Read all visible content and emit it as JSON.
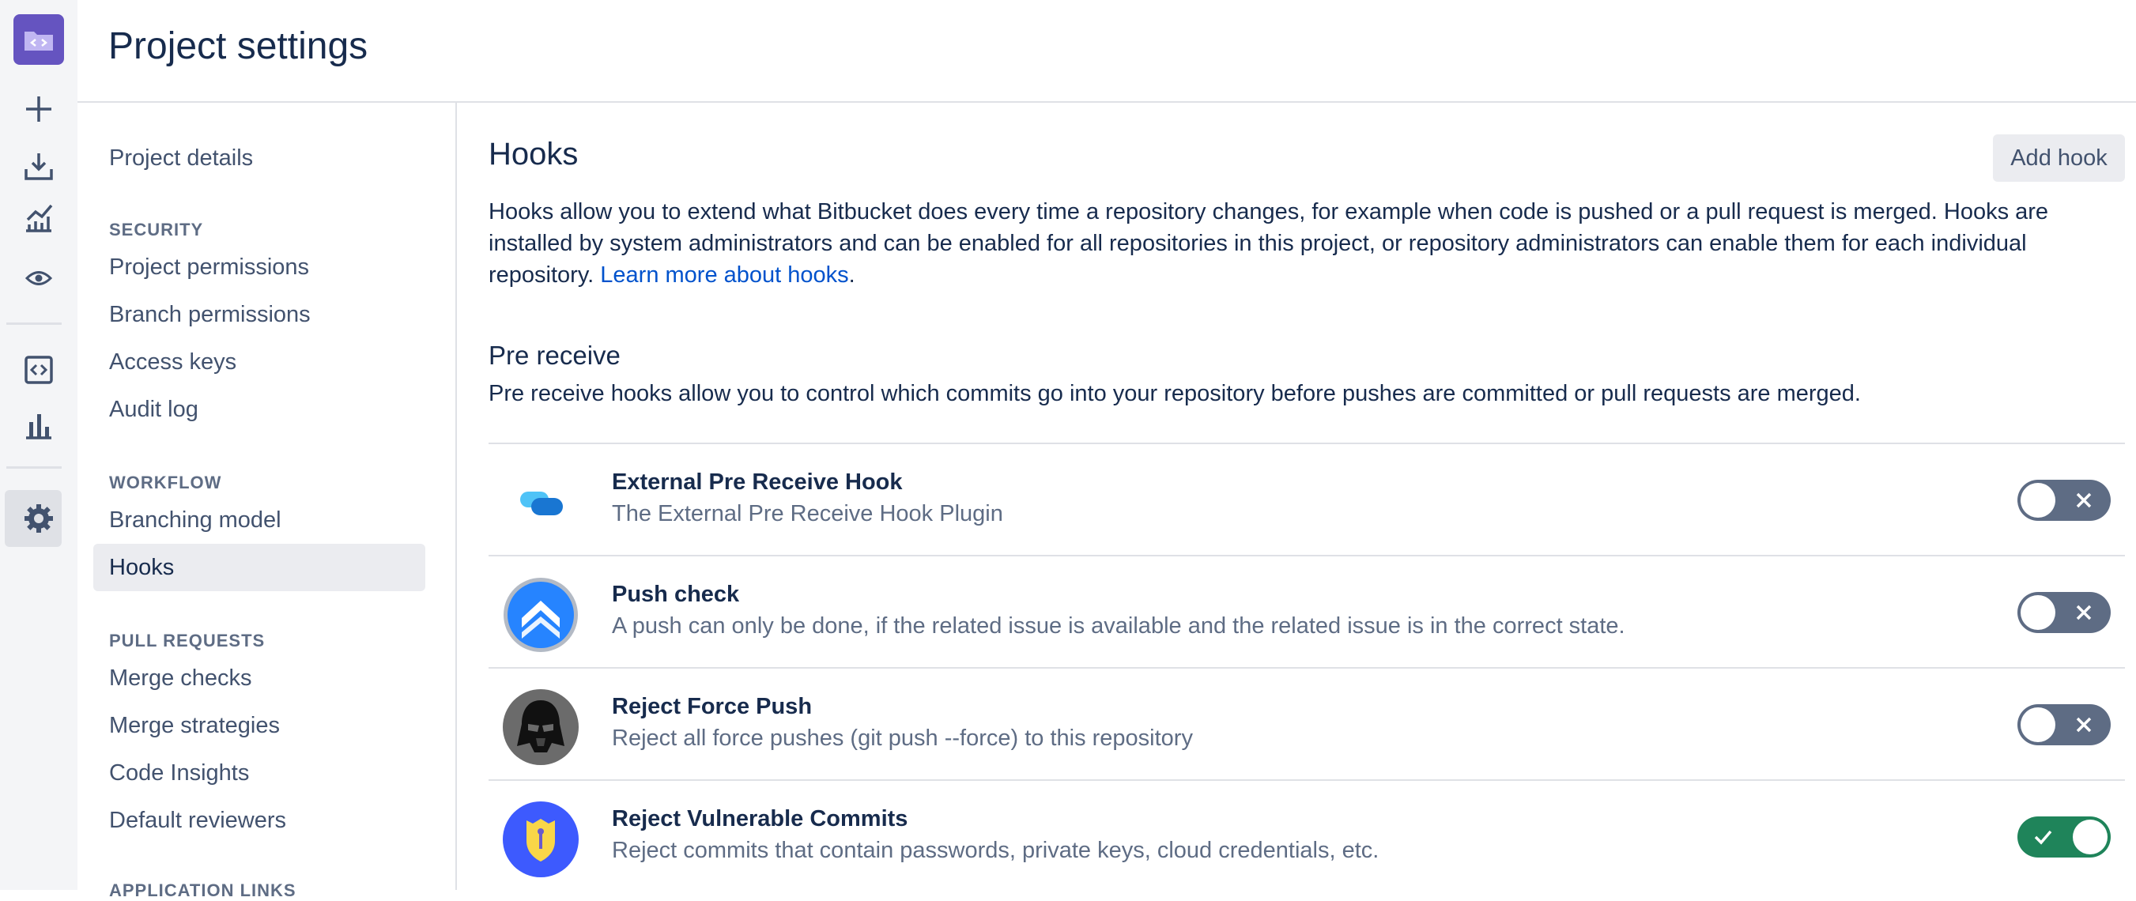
{
  "header": {
    "title": "Project settings"
  },
  "rail": {
    "icons": [
      "project-avatar-icon",
      "create-icon",
      "clone-icon",
      "insights-icon",
      "watch-icon",
      "code-icon",
      "chart-icon",
      "settings-icon"
    ]
  },
  "nav": {
    "project_details": "Project details",
    "security_heading": "SECURITY",
    "security_items": [
      "Project permissions",
      "Branch permissions",
      "Access keys",
      "Audit log"
    ],
    "workflow_heading": "WORKFLOW",
    "workflow_items": [
      "Branching model",
      "Hooks"
    ],
    "pull_requests_heading": "PULL REQUESTS",
    "pull_requests_items": [
      "Merge checks",
      "Merge strategies",
      "Code Insights",
      "Default reviewers"
    ],
    "app_links_heading": "APPLICATION LINKS",
    "selected": "Hooks"
  },
  "main": {
    "title": "Hooks",
    "add_hook_label": "Add hook",
    "intro_text": "Hooks allow you to extend what Bitbucket does every time a repository changes, for example when code is pushed or a pull request is merged. Hooks are installed by system administrators and can be enabled for all repositories in this project, or repository administrators can enable them for each individual repository.",
    "intro_link": "Learn more about hooks",
    "pre_receive": {
      "title": "Pre receive",
      "description": "Pre receive hooks allow you to control which commits go into your repository before pushes are committed or pull requests are merged.",
      "hooks": [
        {
          "name": "External Pre Receive Hook",
          "description": "The External Pre Receive Hook Plugin",
          "enabled": false
        },
        {
          "name": "Push check",
          "description": "A push can only be done, if the related issue is available and the related issue is in the correct state.",
          "enabled": false
        },
        {
          "name": "Reject Force Push",
          "description": "Reject all force pushes (git push --force) to this repository",
          "enabled": false
        },
        {
          "name": "Reject Vulnerable Commits",
          "description": "Reject commits that contain passwords, private keys, cloud credentials, etc.",
          "enabled": true
        }
      ]
    }
  },
  "colors": {
    "rail_bg": "#f4f5f7",
    "accent_purple": "#6554c0",
    "link": "#0052cc",
    "toggle_off": "#5e6c84",
    "toggle_on": "#1f845a"
  }
}
